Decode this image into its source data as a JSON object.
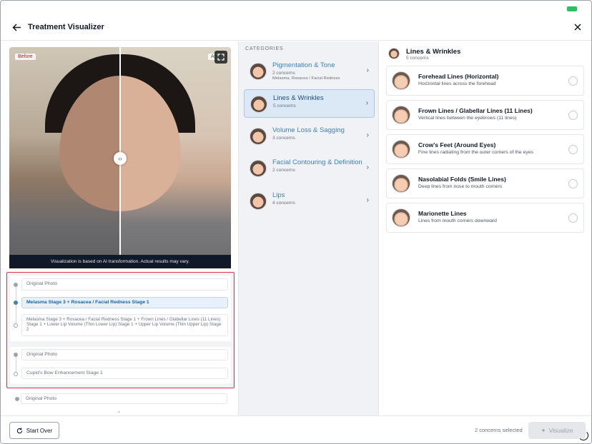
{
  "header": {
    "title": "Treatment Visualizer"
  },
  "photo": {
    "before_label": "Before",
    "after_label": "After",
    "caption": "Visualization is based on AI transformation. Actual results may vary."
  },
  "history": {
    "group1": [
      {
        "label": "Original Photo"
      },
      {
        "label": "Melasma Stage 3  +  Rosacea / Facial Redness Stage 1"
      },
      {
        "label": "Melasma Stage 3  +  Rosacea / Facial Redness Stage 1  +  Frown Lines / Glabellar Lines (11 Lines) Stage 1  +  Lower Lip Volume (Thin Lower Lip) Stage 1  +  Upper Lip Volume (Thin Upper Lip) Stage 2"
      }
    ],
    "group2": [
      {
        "label": "Original Photo"
      },
      {
        "label": "Cupid's Bow Enhancement Stage 1"
      }
    ],
    "group3": [
      {
        "label": "Original Photo"
      }
    ]
  },
  "categories": {
    "heading": "CATEGORIES",
    "items": [
      {
        "title": "Pigmentation & Tone",
        "count": "2 concerns",
        "detail": "Melasma, Rosacea / Facial Redness"
      },
      {
        "title": "Lines & Wrinkles",
        "count": "5 concerns",
        "detail": ""
      },
      {
        "title": "Volume Loss & Sagging",
        "count": "3 concerns",
        "detail": ""
      },
      {
        "title": "Facial Contouring & Definition",
        "count": "2 concerns",
        "detail": ""
      },
      {
        "title": "Lips",
        "count": "4 concerns",
        "detail": ""
      }
    ]
  },
  "detail": {
    "title": "Lines & Wrinkles",
    "count": "5 concerns",
    "concerns": [
      {
        "title": "Forehead Lines (Horizontal)",
        "desc": "Horizontal lines across the forehead"
      },
      {
        "title": "Frown Lines / Glabellar Lines (11 Lines)",
        "desc": "Vertical lines between the eyebrows (11 lines)"
      },
      {
        "title": "Crow's Feet (Around Eyes)",
        "desc": "Fine lines radiating from the outer corners of the eyes"
      },
      {
        "title": "Nasolabial Folds (Smile Lines)",
        "desc": "Deep lines from nose to mouth corners"
      },
      {
        "title": "Marionette Lines",
        "desc": "Lines from mouth corners downward"
      }
    ]
  },
  "footer": {
    "start_over": "Start Over",
    "selected_count": "2 concerns selected",
    "visualize": "Visualize"
  },
  "colors": {
    "accent": "#3b82c4",
    "history_border": "#dc2f4a"
  }
}
